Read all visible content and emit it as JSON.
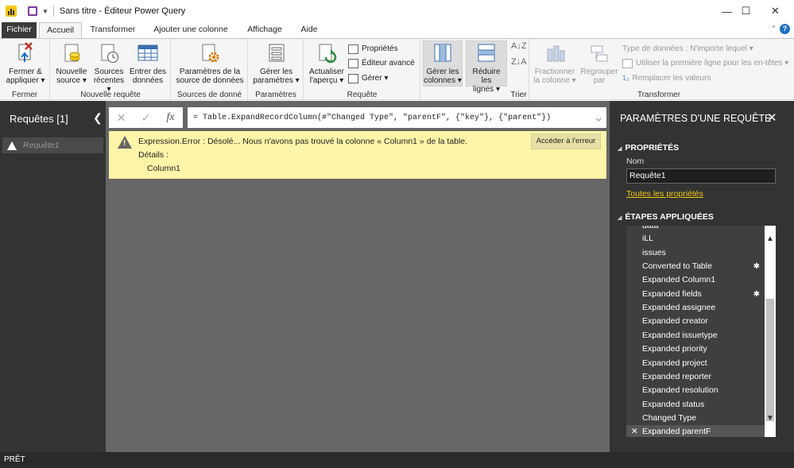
{
  "window": {
    "title": "Sans titre - Éditeur Power Query",
    "minimize": "—",
    "maximize": "☐",
    "close": "✕"
  },
  "tabs": [
    "Fichier",
    "Accueil",
    "Transformer",
    "Ajouter une colonne",
    "Affichage",
    "Aide"
  ],
  "help": "?",
  "ribbon": {
    "fermer": {
      "btn1": "Fermer &",
      "btn2": "appliquer ▾",
      "label": "Fermer"
    },
    "nouvelle": {
      "b1a": "Nouvelle",
      "b1b": "source ▾",
      "b2a": "Sources",
      "b2b": "récentes ▾",
      "b3a": "Entrer des",
      "b3b": "données",
      "label": "Nouvelle requête"
    },
    "sources": {
      "ba": "Paramètres de la",
      "bb": "source de données",
      "label": "Sources de donné"
    },
    "params": {
      "ba": "Gérer les",
      "bb": "paramètres ▾",
      "label": "Paramètres"
    },
    "requete": {
      "b1a": "Actualiser",
      "b1b": "l'aperçu ▾",
      "props": "Propriétés",
      "editor": "Éditeur avancé",
      "manage": "Gérer ▾",
      "label": "Requête"
    },
    "cols": {
      "ba": "Gérer les",
      "bb": "colonnes ▾"
    },
    "rows": {
      "ba": "Réduire les",
      "bb": "lignes ▾"
    },
    "trier": {
      "label": "Trier"
    },
    "transformer": {
      "b1a": "Fractionner",
      "b1b": "la colonne ▾",
      "b2a": "Regrouper",
      "b2b": "par",
      "dtype": "Type de données : N'importe lequel ▾",
      "firstrow": "Utiliser la première ligne pour les en-têtes ▾",
      "replace": "Remplacer les valeurs",
      "label": "Transformer"
    }
  },
  "left": {
    "title": "Requêtes [1]",
    "collapse": "❮",
    "query": "Requête1"
  },
  "formula_bar": {
    "cancel": "✕",
    "confirm": "✓",
    "fx": "fx",
    "formula": "= Table.ExpandRecordColumn(#\"Changed Type\", \"parentF\", {\"key\"}, {\"parent\"})",
    "expand": "⌵"
  },
  "error": {
    "message": "Expression.Error : Désolé... Nous n'avons pas trouvé la colonne « Column1 » de la table.",
    "details_label": "Détails :",
    "details_value": "Column1",
    "button": "Accéder à l'erreur"
  },
  "right": {
    "title": "PARAMÈTRES D'UNE REQUÊTE",
    "close": "✕",
    "props_header": "PROPRIÉTÉS",
    "name_label": "Nom",
    "name_value": "Requête1",
    "all_props": "Toutes les propriétés",
    "steps_header": "ÉTAPES APPLIQUÉES",
    "steps": [
      "data",
      "iLL",
      "issues",
      "Converted to Table",
      "Expanded Column1",
      "Expanded fields",
      "Expanded assignee",
      "Expanded creator",
      "Expanded issuetype",
      "Expanded priority",
      "Expanded project",
      "Expanded reporter",
      "Expanded resolution",
      "Expanded status",
      "Changed Type",
      "Expanded parentF"
    ],
    "gear": "✱",
    "delete": "✕",
    "scroll_up": "▲",
    "scroll_down": "▼"
  },
  "status": "PRÊT",
  "colors": {
    "accent": "#f2c811",
    "error_bg": "#fff5a8",
    "pane_dark": "#333333",
    "canvas": "#666666"
  }
}
